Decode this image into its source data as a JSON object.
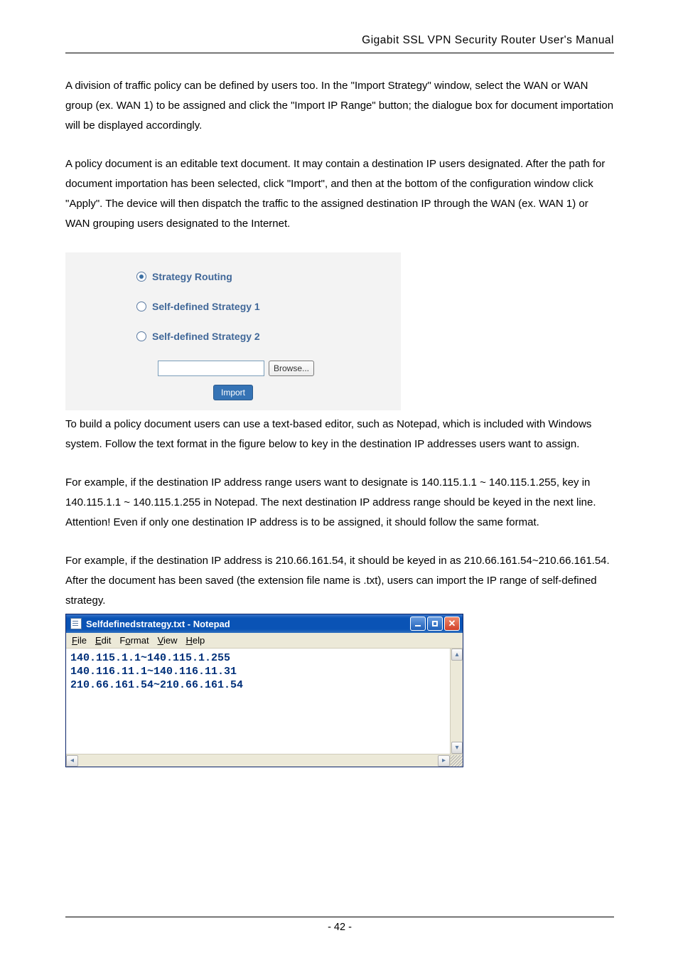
{
  "header": {
    "title": "Gigabit  SSL  VPN  Security  Router  User's  Manual"
  },
  "body": {
    "p1": "A division of traffic policy can be defined by users too. In the \"Import Strategy\" window, select the WAN or WAN group (ex. WAN 1) to be assigned and click the \"Import IP Range\" button; the dialogue box for document importation will be displayed accordingly.",
    "p2": "A policy document is an editable text document. It may contain a destination IP users designated. After the path for document importation has been selected, click \"Import\", and then at the bottom of the configuration window click \"Apply\". The device will then dispatch the traffic to the assigned destination IP through the WAN (ex. WAN 1) or WAN grouping users designated to the Internet.",
    "p3": "To build a policy document users can use a text-based editor, such as Notepad, which is included with Windows system. Follow the text format in the figure below to key in the destination IP addresses users want to assign.",
    "p4": "For example, if the destination IP address range users want to designate is 140.115.1.1 ~ 140.115.1.255, key in 140.115.1.1 ~ 140.115.1.255 in Notepad. The next destination IP address range should be keyed in the next line. Attention! Even if only one destination IP address is to be assigned, it should follow the same format.",
    "p5": "For example, if the destination IP address is 210.66.161.54, it should be keyed in as 210.66.161.54~210.66.161.54. After the document has been saved (the extension file name is .txt), users can import the IP range of self-defined strategy."
  },
  "strategy_panel": {
    "option1": "Strategy Routing",
    "option2": "Self-defined Strategy 1",
    "option3": "Self-defined Strategy 2",
    "browse_label": "Browse...",
    "import_label": "Import"
  },
  "notepad": {
    "title": "Selfdefinedstrategy.txt - Notepad",
    "menu": {
      "file": "File",
      "edit": "Edit",
      "format": "Format",
      "view": "View",
      "help": "Help"
    },
    "content": "140.115.1.1~140.115.1.255\n140.116.11.1~140.116.11.31\n210.66.161.54~210.66.161.54"
  },
  "footer": {
    "page": "- 42 -"
  }
}
